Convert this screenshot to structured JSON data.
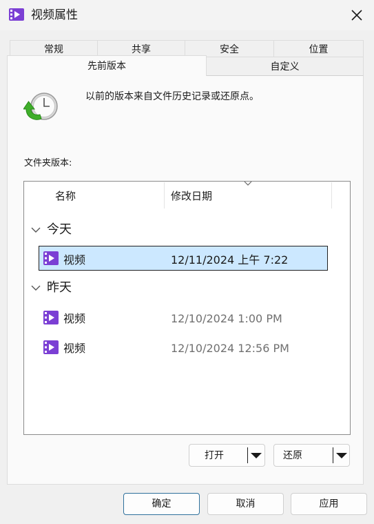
{
  "window": {
    "title": "视频属性"
  },
  "tabs": {
    "row1": [
      "常规",
      "共享",
      "安全",
      "位置"
    ],
    "previous_versions": "先前版本",
    "customize": "自定义"
  },
  "panel": {
    "description": "以前的版本来自文件历史记录或还原点。",
    "versions_label": "文件夹版本:"
  },
  "list": {
    "columns": {
      "name": "名称",
      "modified": "修改日期"
    },
    "groups": [
      {
        "label": "今天",
        "items": [
          {
            "name": "视频",
            "date": "12/11/2024 上午 7:22"
          }
        ]
      },
      {
        "label": "昨天",
        "items": [
          {
            "name": "视频",
            "date": "12/10/2024 1:00 PM"
          },
          {
            "name": "视频",
            "date": "12/10/2024 12:56 PM"
          }
        ]
      }
    ]
  },
  "actions": {
    "open": "打开",
    "restore": "还原"
  },
  "footer": {
    "ok": "确定",
    "cancel": "取消",
    "apply": "应用"
  },
  "colors": {
    "selection": "#cce8ff",
    "folder_icon": "#7b3fd4"
  }
}
